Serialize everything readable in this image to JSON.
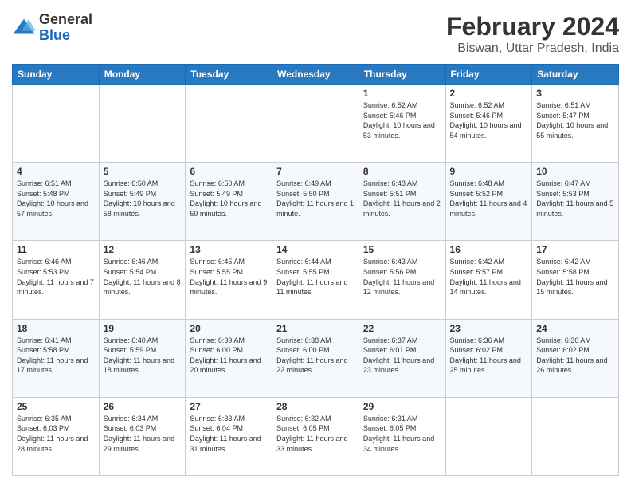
{
  "logo": {
    "general": "General",
    "blue": "Blue"
  },
  "header": {
    "title": "February 2024",
    "subtitle": "Biswan, Uttar Pradesh, India"
  },
  "days": [
    "Sunday",
    "Monday",
    "Tuesday",
    "Wednesday",
    "Thursday",
    "Friday",
    "Saturday"
  ],
  "weeks": [
    [
      {
        "num": "",
        "info": ""
      },
      {
        "num": "",
        "info": ""
      },
      {
        "num": "",
        "info": ""
      },
      {
        "num": "",
        "info": ""
      },
      {
        "num": "1",
        "info": "Sunrise: 6:52 AM\nSunset: 5:46 PM\nDaylight: 10 hours and 53 minutes."
      },
      {
        "num": "2",
        "info": "Sunrise: 6:52 AM\nSunset: 5:46 PM\nDaylight: 10 hours and 54 minutes."
      },
      {
        "num": "3",
        "info": "Sunrise: 6:51 AM\nSunset: 5:47 PM\nDaylight: 10 hours and 55 minutes."
      }
    ],
    [
      {
        "num": "4",
        "info": "Sunrise: 6:51 AM\nSunset: 5:48 PM\nDaylight: 10 hours and 57 minutes."
      },
      {
        "num": "5",
        "info": "Sunrise: 6:50 AM\nSunset: 5:49 PM\nDaylight: 10 hours and 58 minutes."
      },
      {
        "num": "6",
        "info": "Sunrise: 6:50 AM\nSunset: 5:49 PM\nDaylight: 10 hours and 59 minutes."
      },
      {
        "num": "7",
        "info": "Sunrise: 6:49 AM\nSunset: 5:50 PM\nDaylight: 11 hours and 1 minute."
      },
      {
        "num": "8",
        "info": "Sunrise: 6:48 AM\nSunset: 5:51 PM\nDaylight: 11 hours and 2 minutes."
      },
      {
        "num": "9",
        "info": "Sunrise: 6:48 AM\nSunset: 5:52 PM\nDaylight: 11 hours and 4 minutes."
      },
      {
        "num": "10",
        "info": "Sunrise: 6:47 AM\nSunset: 5:53 PM\nDaylight: 11 hours and 5 minutes."
      }
    ],
    [
      {
        "num": "11",
        "info": "Sunrise: 6:46 AM\nSunset: 5:53 PM\nDaylight: 11 hours and 7 minutes."
      },
      {
        "num": "12",
        "info": "Sunrise: 6:46 AM\nSunset: 5:54 PM\nDaylight: 11 hours and 8 minutes."
      },
      {
        "num": "13",
        "info": "Sunrise: 6:45 AM\nSunset: 5:55 PM\nDaylight: 11 hours and 9 minutes."
      },
      {
        "num": "14",
        "info": "Sunrise: 6:44 AM\nSunset: 5:55 PM\nDaylight: 11 hours and 11 minutes."
      },
      {
        "num": "15",
        "info": "Sunrise: 6:43 AM\nSunset: 5:56 PM\nDaylight: 11 hours and 12 minutes."
      },
      {
        "num": "16",
        "info": "Sunrise: 6:42 AM\nSunset: 5:57 PM\nDaylight: 11 hours and 14 minutes."
      },
      {
        "num": "17",
        "info": "Sunrise: 6:42 AM\nSunset: 5:58 PM\nDaylight: 11 hours and 15 minutes."
      }
    ],
    [
      {
        "num": "18",
        "info": "Sunrise: 6:41 AM\nSunset: 5:58 PM\nDaylight: 11 hours and 17 minutes."
      },
      {
        "num": "19",
        "info": "Sunrise: 6:40 AM\nSunset: 5:59 PM\nDaylight: 11 hours and 18 minutes."
      },
      {
        "num": "20",
        "info": "Sunrise: 6:39 AM\nSunset: 6:00 PM\nDaylight: 11 hours and 20 minutes."
      },
      {
        "num": "21",
        "info": "Sunrise: 6:38 AM\nSunset: 6:00 PM\nDaylight: 11 hours and 22 minutes."
      },
      {
        "num": "22",
        "info": "Sunrise: 6:37 AM\nSunset: 6:01 PM\nDaylight: 11 hours and 23 minutes."
      },
      {
        "num": "23",
        "info": "Sunrise: 6:36 AM\nSunset: 6:02 PM\nDaylight: 11 hours and 25 minutes."
      },
      {
        "num": "24",
        "info": "Sunrise: 6:36 AM\nSunset: 6:02 PM\nDaylight: 11 hours and 26 minutes."
      }
    ],
    [
      {
        "num": "25",
        "info": "Sunrise: 6:35 AM\nSunset: 6:03 PM\nDaylight: 11 hours and 28 minutes."
      },
      {
        "num": "26",
        "info": "Sunrise: 6:34 AM\nSunset: 6:03 PM\nDaylight: 11 hours and 29 minutes."
      },
      {
        "num": "27",
        "info": "Sunrise: 6:33 AM\nSunset: 6:04 PM\nDaylight: 11 hours and 31 minutes."
      },
      {
        "num": "28",
        "info": "Sunrise: 6:32 AM\nSunset: 6:05 PM\nDaylight: 11 hours and 33 minutes."
      },
      {
        "num": "29",
        "info": "Sunrise: 6:31 AM\nSunset: 6:05 PM\nDaylight: 11 hours and 34 minutes."
      },
      {
        "num": "",
        "info": ""
      },
      {
        "num": "",
        "info": ""
      }
    ]
  ]
}
